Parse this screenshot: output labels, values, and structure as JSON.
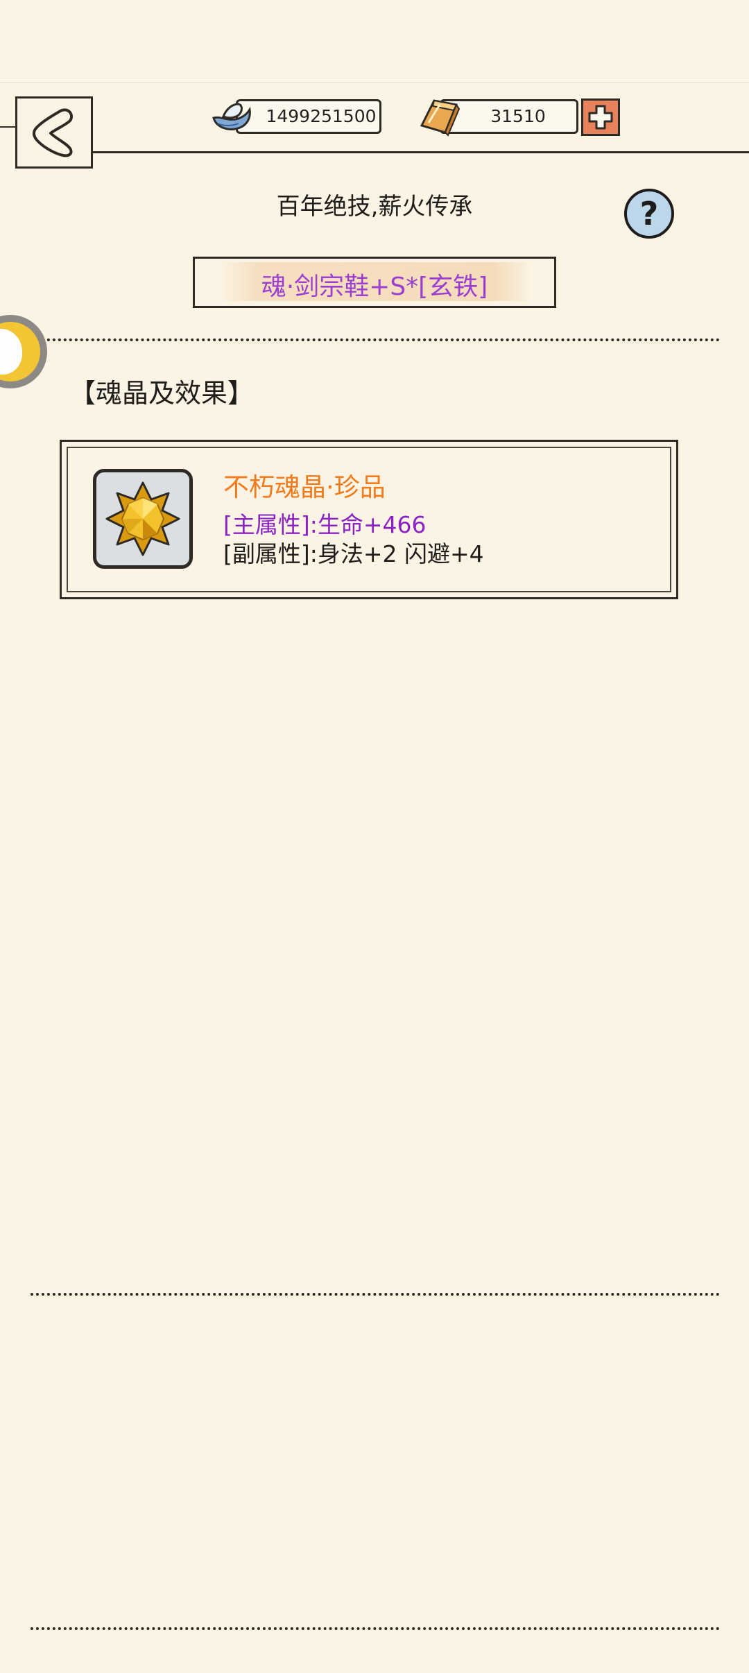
{
  "header": {
    "silver_amount": "1499251500",
    "gold_amount": "31510"
  },
  "page": {
    "title": "百年绝技,薪火传承",
    "help_label": "?",
    "item_name": "魂·剑宗鞋+S*[玄铁]",
    "section_title": "【魂晶及效果】"
  },
  "crystal": {
    "name": "不朽魂晶·珍品",
    "main_attr": "[主属性]:生命+466",
    "sub_attr": "[副属性]:身法+2 闪避+4",
    "icon": "gold-star-crystal-icon"
  },
  "colors": {
    "background": "#fbf3e3",
    "item_name": "#9a3fcf",
    "crystal_name": "#f07c1e",
    "main_attr": "#8a22c4",
    "add_button": "#e8825a",
    "help_button": "#bcd6ea"
  }
}
